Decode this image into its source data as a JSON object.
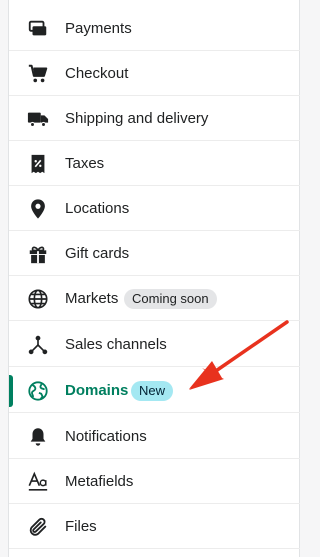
{
  "settings_menu": {
    "items": [
      {
        "label": "Payments",
        "icon": "payments-icon"
      },
      {
        "label": "Checkout",
        "icon": "cart-icon"
      },
      {
        "label": "Shipping and delivery",
        "icon": "truck-icon"
      },
      {
        "label": "Taxes",
        "icon": "tax-receipt-icon"
      },
      {
        "label": "Locations",
        "icon": "location-pin-icon"
      },
      {
        "label": "Gift cards",
        "icon": "gift-icon"
      },
      {
        "label": "Markets",
        "icon": "globe-icon",
        "badge": "Coming soon"
      },
      {
        "label": "Sales channels",
        "icon": "channels-icon"
      },
      {
        "label": "Domains",
        "icon": "globe-icon",
        "badge": "New",
        "active": true
      },
      {
        "label": "Notifications",
        "icon": "bell-icon"
      },
      {
        "label": "Metafields",
        "icon": "metafields-icon"
      },
      {
        "label": "Files",
        "icon": "paperclip-icon"
      }
    ]
  },
  "colors": {
    "active_text": "#007f5f",
    "active_bar": "#008060",
    "new_badge": "#a4e8f2",
    "soon_badge": "#e4e5e7",
    "arrow": "#e8321e"
  }
}
